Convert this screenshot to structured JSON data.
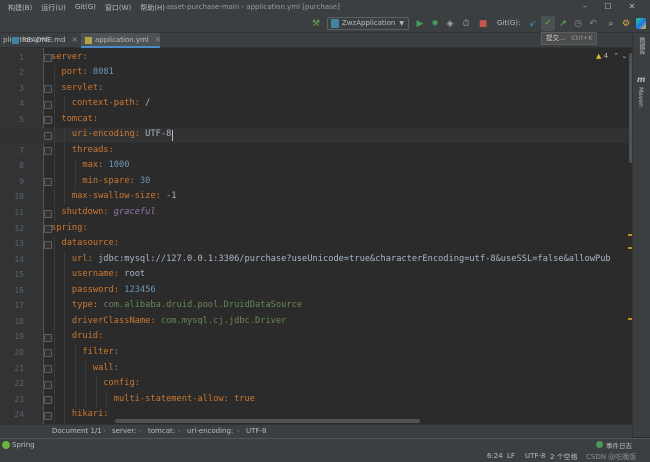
{
  "window": {
    "menu": [
      "构建(B)",
      "运行(U)",
      "Git(G)",
      "窗口(W)",
      "帮助(H)"
    ],
    "title": "asset-purchase-main - application.yml [purchase]",
    "minimize": "–",
    "maximize": "☐",
    "close": "✕"
  },
  "toolbar": {
    "hammer": "⚒",
    "run_config": "ZwzApplication",
    "run": "▶",
    "debug": "✹",
    "coverage": "◈",
    "profile": "⏱",
    "stop": "■",
    "git_label": "Git(G):",
    "update": "↙",
    "commit": "✓",
    "push": "↗",
    "history": "◷",
    "rollback": "↶",
    "search": "⌕",
    "settings": "⚙"
  },
  "tooltip": {
    "label": "提交...",
    "shortcut": "Ctrl+K"
  },
  "tabs": [
    {
      "label": "plication.yml",
      "active": false,
      "close": "✕"
    },
    {
      "label": "README.md",
      "active": false,
      "close": "✕"
    },
    {
      "label": "application.yml",
      "active": true,
      "close": "✕"
    }
  ],
  "right_strip": {
    "database": "数据库",
    "maven_glyph": "m",
    "maven": "Maven"
  },
  "inspection": {
    "icon": "▲",
    "count": "4",
    "up": "⌃",
    "down": "⌄"
  },
  "editor": {
    "current_line": 6,
    "lines": [
      {
        "n": "1",
        "indent": "",
        "parts": [
          {
            "t": "server:",
            "c": "k"
          }
        ]
      },
      {
        "n": "2",
        "indent": "  ",
        "parts": [
          {
            "t": "port: ",
            "c": "k"
          },
          {
            "t": "8081",
            "c": "n"
          }
        ]
      },
      {
        "n": "3",
        "indent": "  ",
        "parts": [
          {
            "t": "servlet:",
            "c": "k"
          }
        ]
      },
      {
        "n": "4",
        "indent": "    ",
        "parts": [
          {
            "t": "context-path: ",
            "c": "k"
          },
          {
            "t": "/",
            "c": "p"
          }
        ]
      },
      {
        "n": "5",
        "indent": "  ",
        "parts": [
          {
            "t": "tomcat:",
            "c": "k"
          }
        ]
      },
      {
        "n": "6",
        "indent": "    ",
        "parts": [
          {
            "t": "uri-encoding: ",
            "c": "k"
          },
          {
            "t": "UTF-8",
            "c": "p"
          }
        ]
      },
      {
        "n": "7",
        "indent": "    ",
        "parts": [
          {
            "t": "threads:",
            "c": "k"
          }
        ]
      },
      {
        "n": "8",
        "indent": "      ",
        "parts": [
          {
            "t": "max: ",
            "c": "k"
          },
          {
            "t": "1000",
            "c": "n"
          }
        ]
      },
      {
        "n": "9",
        "indent": "      ",
        "parts": [
          {
            "t": "min-spare: ",
            "c": "k"
          },
          {
            "t": "30",
            "c": "n"
          }
        ]
      },
      {
        "n": "10",
        "indent": "    ",
        "parts": [
          {
            "t": "max-swallow-size: ",
            "c": "k"
          },
          {
            "t": "-1",
            "c": "p"
          }
        ]
      },
      {
        "n": "11",
        "indent": "  ",
        "parts": [
          {
            "t": "shutdown: ",
            "c": "k"
          },
          {
            "t": "graceful",
            "c": "i"
          }
        ]
      },
      {
        "n": "12",
        "indent": "",
        "parts": [
          {
            "t": "spring:",
            "c": "k"
          }
        ]
      },
      {
        "n": "13",
        "indent": "  ",
        "parts": [
          {
            "t": "datasource:",
            "c": "k"
          }
        ]
      },
      {
        "n": "14",
        "indent": "    ",
        "parts": [
          {
            "t": "url: ",
            "c": "k"
          },
          {
            "t": "jdbc:mysql://127.0.0.1:3306/purchase?useUnicode=true&characterEncoding=utf-8&useSSL=false&allowPub",
            "c": "p"
          }
        ]
      },
      {
        "n": "15",
        "indent": "    ",
        "parts": [
          {
            "t": "username: ",
            "c": "k"
          },
          {
            "t": "root",
            "c": "p"
          }
        ]
      },
      {
        "n": "16",
        "indent": "    ",
        "parts": [
          {
            "t": "password: ",
            "c": "k"
          },
          {
            "t": "123456",
            "c": "n"
          }
        ]
      },
      {
        "n": "17",
        "indent": "    ",
        "parts": [
          {
            "t": "type: ",
            "c": "k"
          },
          {
            "t": "com.alibaba.druid.pool.DruidDataSource",
            "c": "s"
          }
        ]
      },
      {
        "n": "18",
        "indent": "    ",
        "parts": [
          {
            "t": "driverClassName: ",
            "c": "k"
          },
          {
            "t": "com.mysql.cj.jdbc.Driver",
            "c": "s"
          }
        ]
      },
      {
        "n": "19",
        "indent": "    ",
        "parts": [
          {
            "t": "druid:",
            "c": "k"
          }
        ]
      },
      {
        "n": "20",
        "indent": "      ",
        "parts": [
          {
            "t": "filter:",
            "c": "k"
          }
        ]
      },
      {
        "n": "21",
        "indent": "        ",
        "parts": [
          {
            "t": "wall:",
            "c": "k"
          }
        ]
      },
      {
        "n": "22",
        "indent": "          ",
        "parts": [
          {
            "t": "config:",
            "c": "k"
          }
        ]
      },
      {
        "n": "23",
        "indent": "            ",
        "parts": [
          {
            "t": "multi-statement-allow: ",
            "c": "k"
          },
          {
            "t": "true",
            "c": "k"
          }
        ]
      },
      {
        "n": "24",
        "indent": "    ",
        "parts": [
          {
            "t": "hikari:",
            "c": "k"
          }
        ]
      }
    ]
  },
  "breadcrumb": [
    "Document 1/1",
    "server:",
    "tomcat:",
    "uri-encoding:",
    "UTF-8"
  ],
  "breadcrumb_sep": "›",
  "status": {
    "left": "Spring",
    "event_log": "事件日志",
    "position": "6:24",
    "line_sep": "LF",
    "encoding": "UTF-8",
    "indent": "2 个空格",
    "watermark": "CSDN @吃晚饭"
  },
  "colors": {
    "accent": "#4a88c7",
    "keyword": "#cc7832",
    "number": "#6897bb",
    "string": "#6a8759",
    "run": "#499c54",
    "commit": "#62b543"
  }
}
